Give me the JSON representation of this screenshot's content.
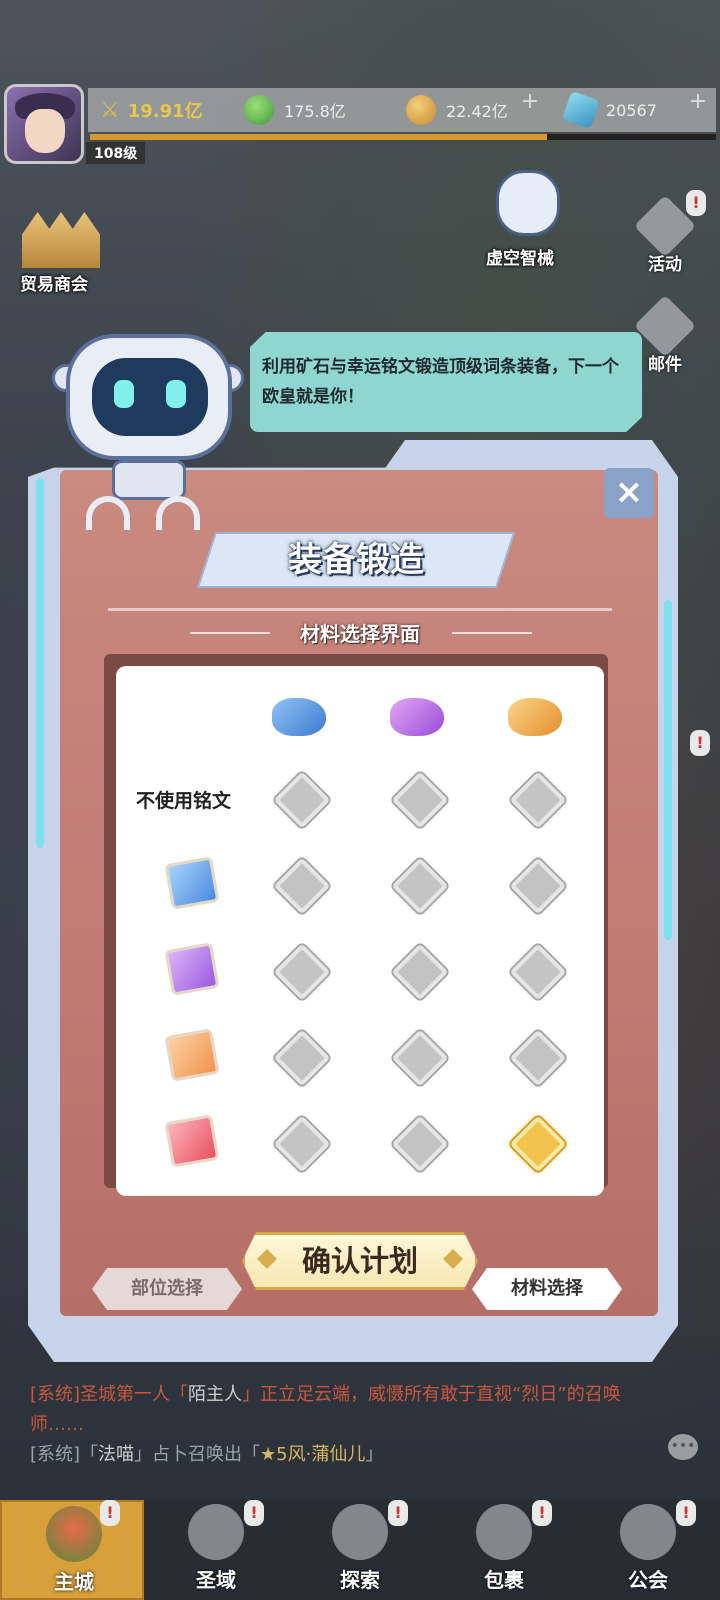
{
  "hud": {
    "power": "19.91亿",
    "green_currency": "175.8亿",
    "gold_currency": "22.42亿",
    "diamond_currency": "20567",
    "level": "108级",
    "plus": "+"
  },
  "side": {
    "trade_guild": "贸易商会",
    "void_mech": "虚空智械",
    "activity": "活动",
    "mail": "邮件",
    "badge": "!"
  },
  "bubble_text": "利用矿石与幸运铭文锻造顶级词条装备，下一个欧皇就是你！",
  "panel": {
    "close": "×",
    "title": "装备锻造",
    "subtitle": "材料选择界面",
    "row_no_inscription": "不使用铭文",
    "confirm": "确认计划",
    "part_select": "部位选择",
    "material_select": "材料选择"
  },
  "chat": {
    "line1_prefix": "[系统]圣城第一人「",
    "line1_name": "陌主人",
    "line1_suffix": "」正立足云端，威慑所有敢于直视“烈日”的召唤师……",
    "line2_prefix": "[系统]「",
    "line2_name": "法喵",
    "line2_mid": "」占卜召唤出「",
    "line2_hero": "★5风·蒲仙儿",
    "line2_end": "」",
    "chat_icon": "•••"
  },
  "nav": [
    {
      "label": "主城"
    },
    {
      "label": "圣域"
    },
    {
      "label": "探索"
    },
    {
      "label": "包裹"
    },
    {
      "label": "公会"
    }
  ],
  "colors": {
    "selected_cell": "#f2c34e",
    "ore_blue": "#5b9be8",
    "ore_purple": "#b56ce6",
    "ore_orange": "#f3a84a"
  },
  "material_grid": {
    "columns": [
      "blue-ore",
      "purple-ore",
      "orange-ore"
    ],
    "rows": [
      "no-inscription",
      "blue-inscription",
      "purple-inscription",
      "orange-inscription",
      "red-inscription"
    ],
    "selected": {
      "row": "red-inscription",
      "column": "orange-ore"
    }
  }
}
